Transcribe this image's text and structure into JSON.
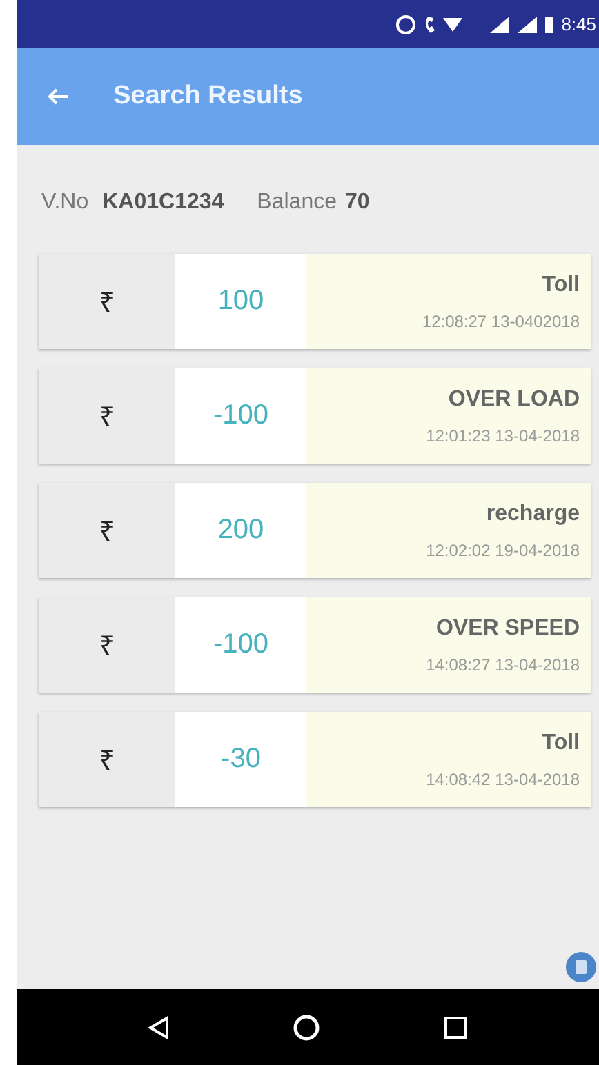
{
  "status_bar": {
    "time": "8:45"
  },
  "app_bar": {
    "title": "Search Results"
  },
  "summary": {
    "vehicle_label": "V.No",
    "vehicle_number": "KA01C1234",
    "balance_label": "Balance",
    "balance": "70"
  },
  "transactions": [
    {
      "currency": "₹",
      "amount": "100",
      "type": "Toll",
      "timestamp": "12:08:27 13-0402018"
    },
    {
      "currency": "₹",
      "amount": "-100",
      "type": "OVER LOAD",
      "timestamp": "12:01:23 13-04-2018"
    },
    {
      "currency": "₹",
      "amount": "200",
      "type": "recharge",
      "timestamp": "12:02:02 19-04-2018"
    },
    {
      "currency": "₹",
      "amount": "-100",
      "type": "OVER SPEED",
      "timestamp": "14:08:27 13-04-2018"
    },
    {
      "currency": "₹",
      "amount": "-30",
      "type": "Toll",
      "timestamp": "14:08:42 13-04-2018"
    }
  ]
}
